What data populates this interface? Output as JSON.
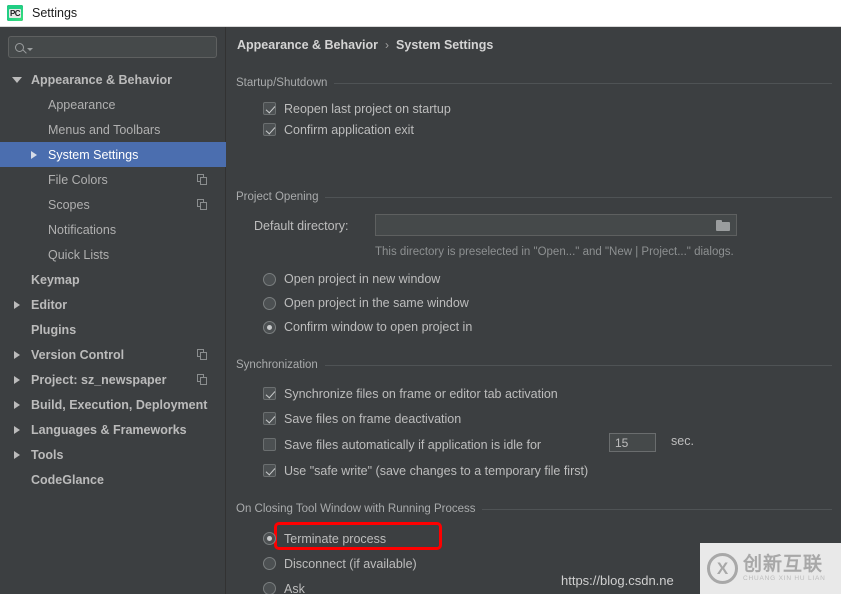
{
  "window": {
    "title": "Settings",
    "app_icon": "pycharm-pc-icon"
  },
  "sidebar": {
    "search": {
      "value": "",
      "placeholder": ""
    },
    "items": [
      {
        "label": "Appearance & Behavior",
        "level": 0,
        "arrow": "down",
        "selected": false,
        "copy_icon": false
      },
      {
        "label": "Appearance",
        "level": 1,
        "arrow": "none",
        "selected": false,
        "copy_icon": false
      },
      {
        "label": "Menus and Toolbars",
        "level": 1,
        "arrow": "none",
        "selected": false,
        "copy_icon": false
      },
      {
        "label": "System Settings",
        "level": 1,
        "arrow": "right",
        "selected": true,
        "copy_icon": false
      },
      {
        "label": "File Colors",
        "level": 1,
        "arrow": "none",
        "selected": false,
        "copy_icon": true
      },
      {
        "label": "Scopes",
        "level": 1,
        "arrow": "none",
        "selected": false,
        "copy_icon": true
      },
      {
        "label": "Notifications",
        "level": 1,
        "arrow": "none",
        "selected": false,
        "copy_icon": false
      },
      {
        "label": "Quick Lists",
        "level": 1,
        "arrow": "none",
        "selected": false,
        "copy_icon": false
      },
      {
        "label": "Keymap",
        "level": 0,
        "arrow": "none",
        "selected": false,
        "copy_icon": false
      },
      {
        "label": "Editor",
        "level": 0,
        "arrow": "right",
        "selected": false,
        "copy_icon": false
      },
      {
        "label": "Plugins",
        "level": 0,
        "arrow": "none",
        "selected": false,
        "copy_icon": false
      },
      {
        "label": "Version Control",
        "level": 0,
        "arrow": "right",
        "selected": false,
        "copy_icon": true
      },
      {
        "label": "Project: sz_newspaper",
        "level": 0,
        "arrow": "right",
        "selected": false,
        "copy_icon": true
      },
      {
        "label": "Build, Execution, Deployment",
        "level": 0,
        "arrow": "right",
        "selected": false,
        "copy_icon": false
      },
      {
        "label": "Languages & Frameworks",
        "level": 0,
        "arrow": "right",
        "selected": false,
        "copy_icon": false
      },
      {
        "label": "Tools",
        "level": 0,
        "arrow": "right",
        "selected": false,
        "copy_icon": false
      },
      {
        "label": "CodeGlance",
        "level": 0,
        "arrow": "none",
        "selected": false,
        "copy_icon": false
      }
    ]
  },
  "breadcrumb": {
    "parent": "Appearance & Behavior",
    "separator": "›",
    "current": "System Settings"
  },
  "sections": {
    "startup": {
      "title": "Startup/Shutdown",
      "options": [
        {
          "label": "Reopen last project on startup",
          "checked": true
        },
        {
          "label": "Confirm application exit",
          "checked": true
        }
      ]
    },
    "project_opening": {
      "title": "Project Opening",
      "dir_label": "Default directory:",
      "dir_value": "",
      "dir_hint": "This directory is preselected in \"Open...\" and \"New | Project...\" dialogs.",
      "radios": [
        {
          "label": "Open project in new window",
          "selected": false
        },
        {
          "label": "Open project in the same window",
          "selected": false
        },
        {
          "label": "Confirm window to open project in",
          "selected": true
        }
      ]
    },
    "synchronization": {
      "title": "Synchronization",
      "options": [
        {
          "label": "Synchronize files on frame or editor tab activation",
          "checked": true
        },
        {
          "label": "Save files on frame deactivation",
          "checked": true
        },
        {
          "label": "Save files automatically if application is idle for",
          "checked": false
        },
        {
          "label": "Use \"safe write\" (save changes to a temporary file first)",
          "checked": true
        }
      ],
      "idle_seconds": "15",
      "idle_unit": "sec."
    },
    "closing_tool_window": {
      "title": "On Closing Tool Window with Running Process",
      "radios": [
        {
          "label": "Terminate process",
          "selected": true,
          "highlighted": true
        },
        {
          "label": "Disconnect (if available)",
          "selected": false,
          "highlighted": false
        },
        {
          "label": "Ask",
          "selected": false,
          "highlighted": false
        }
      ]
    }
  },
  "overlay": {
    "url_text": "https://blog.csdn.ne",
    "watermark_cn": "创新互联",
    "watermark_pinyin": "CHUANG XIN HU LIAN"
  },
  "colors": {
    "accent_selection": "#4b6eaf",
    "highlight_red": "#fe0000",
    "panel_bg": "#3c3f41",
    "titlebar_bg": "#ffffff"
  }
}
